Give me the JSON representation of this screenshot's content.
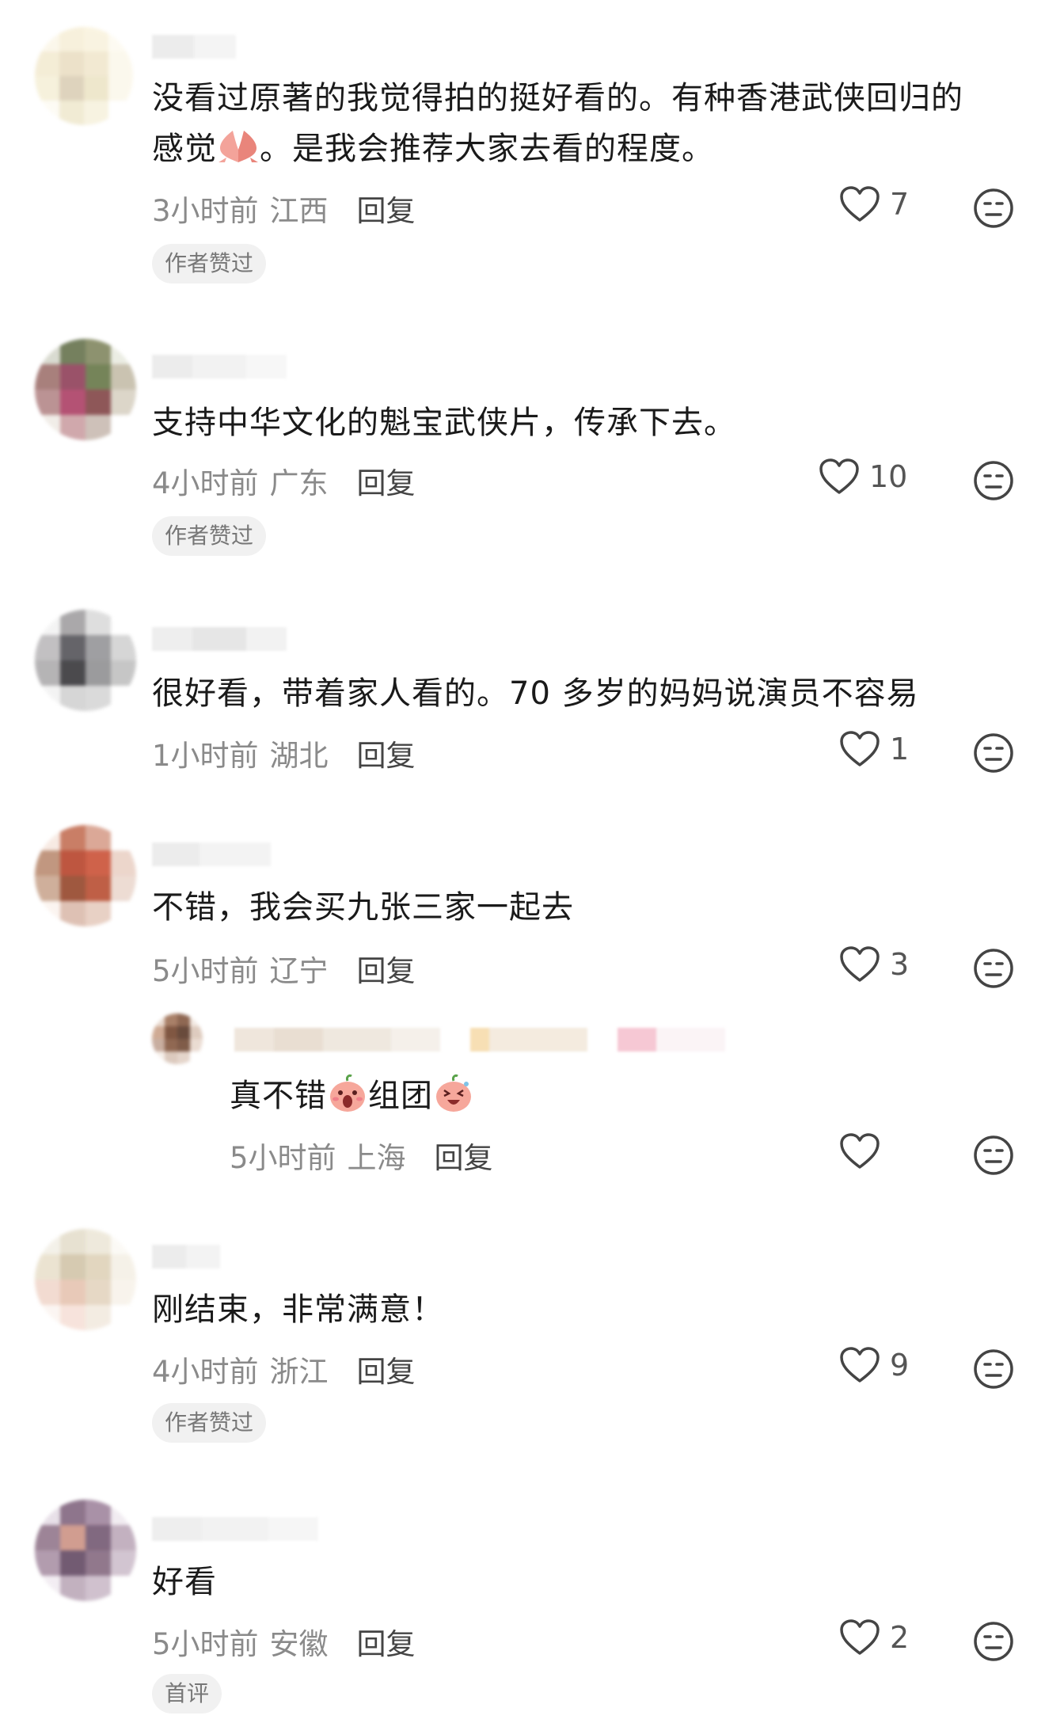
{
  "comments": [
    {
      "text_line1": "没看过原著的我觉得拍的挺好看的。有种香港武侠回归的",
      "text_line2_a": "感觉",
      "text_line2_b": "。是我会推荐大家去看的程度。",
      "time": "3小时前",
      "location": "江西",
      "reply": "回复",
      "likes": "7",
      "badge": "作者赞过"
    },
    {
      "text": "支持中华文化的魁宝武侠片，传承下去。",
      "time": "4小时前",
      "location": "广东",
      "reply": "回复",
      "likes": "10",
      "badge": "作者赞过"
    },
    {
      "text": "很好看，带着家人看的。70 多岁的妈妈说演员不容易",
      "time": "1小时前",
      "location": "湖北",
      "reply": "回复",
      "likes": "1"
    },
    {
      "text": "不错，我会买九张三家一起去",
      "time": "5小时前",
      "location": "辽宁",
      "reply": "回复",
      "likes": "3",
      "sub_reply": {
        "text_a": "真不错",
        "text_b": "组团",
        "time": "5小时前",
        "location": "上海",
        "reply": "回复",
        "likes": ""
      }
    },
    {
      "text": "刚结束，非常满意！",
      "time": "4小时前",
      "location": "浙江",
      "reply": "回复",
      "likes": "9",
      "badge": "作者赞过"
    },
    {
      "text": "好看",
      "time": "5小时前",
      "location": "安徽",
      "reply": "回复",
      "likes": "2",
      "badge": "首评"
    }
  ],
  "icons": {
    "like": "heart-outline-icon",
    "dislike": "neutral-face-icon"
  },
  "colors": {
    "meta_text": "#8a8a8a",
    "badge_bg": "#f1f1f1",
    "icon_stroke": "#444444"
  }
}
